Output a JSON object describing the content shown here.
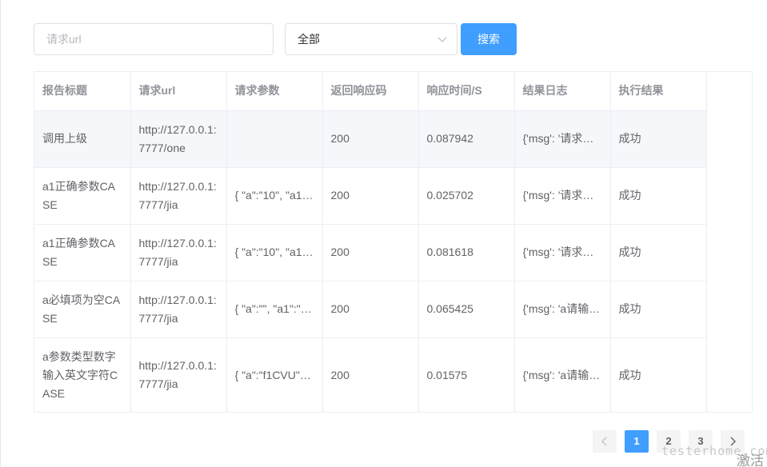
{
  "search": {
    "url_placeholder": "请求url",
    "url_value": "",
    "select_value": "全部",
    "search_label": "搜索"
  },
  "table": {
    "headers": [
      "报告标题",
      "请求url",
      "请求参数",
      "返回响应码",
      "响应时间/S",
      "结果日志",
      "执行结果"
    ],
    "rows": [
      {
        "title": "调用上级",
        "url": "http://127.0.0.1:7777/one",
        "params": "",
        "code": "200",
        "time": "0.087942",
        "log": "{'msg': '请求…",
        "result": "成功"
      },
      {
        "title": "a1正确参数CASE",
        "url": "http://127.0.0.1:7777/jia",
        "params": "{ \"a\":\"10\", \"a1…",
        "code": "200",
        "time": "0.025702",
        "log": "{'msg': '请求…",
        "result": "成功"
      },
      {
        "title": "a1正确参数CASE",
        "url": "http://127.0.0.1:7777/jia",
        "params": "{ \"a\":\"10\", \"a1…",
        "code": "200",
        "time": "0.081618",
        "log": "{'msg': '请求…",
        "result": "成功"
      },
      {
        "title": "a必填项为空CASE",
        "url": "http://127.0.0.1:7777/jia",
        "params": "{ \"a\":\"\", \"a1\":\"…",
        "code": "200",
        "time": "0.065425",
        "log": "{'msg': 'a请输…",
        "result": "成功"
      },
      {
        "title": "a参数类型数字输入英文字符CASE",
        "url": "http://127.0.0.1:7777/jia",
        "params": "{ \"a\":\"f1CVU\"…",
        "code": "200",
        "time": "0.01575",
        "log": "{'msg': 'a请输…",
        "result": "成功"
      }
    ]
  },
  "pagination": {
    "pages": [
      "1",
      "2",
      "3"
    ],
    "current": "1"
  },
  "overlay": {
    "watermark": "testerhome.com",
    "activate": "激活"
  },
  "colors": {
    "primary": "#409eff",
    "border": "#ebeef5",
    "header_text": "#909399",
    "body_text": "#606266",
    "highlight_row": "#f5f7fa"
  },
  "icons": {
    "select_arrow": "chevron-down-icon",
    "prev": "chevron-left-icon",
    "next": "chevron-right-icon"
  }
}
